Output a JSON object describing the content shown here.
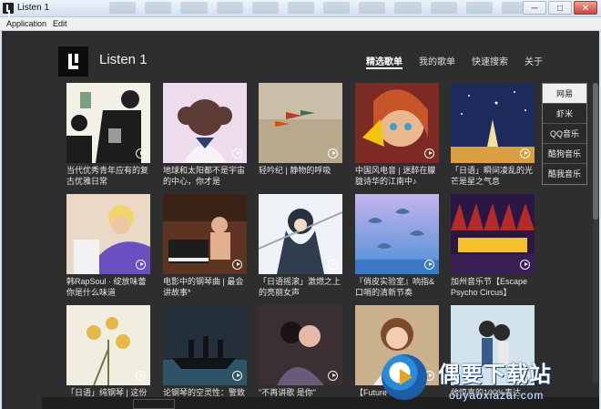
{
  "window": {
    "title": "Listen 1",
    "controls": {
      "minimize": "─",
      "maximize": "□",
      "close": "✕"
    }
  },
  "menu": {
    "items": [
      "Application",
      "Edit"
    ]
  },
  "header": {
    "app_name": "Listen 1",
    "nav": [
      "精选歌单",
      "我的歌单",
      "快速搜索",
      "关于"
    ],
    "active_nav": "精选歌单"
  },
  "sources": {
    "items": [
      "网易",
      "虾米",
      "QQ音乐",
      "酷狗音乐",
      "酷我音乐"
    ],
    "active": "网易"
  },
  "playlists": [
    {
      "title": "当代优秀青年应有的复古优雅日常",
      "art": "art-silhouette",
      "play_icon": "play-circle-icon"
    },
    {
      "title": "地球和太阳都不是宇宙的中心，你才是",
      "art": "art-schoolgirl",
      "play_icon": "play-circle-icon"
    },
    {
      "title": "轻吟纪 | 静物的呼吸",
      "art": "art-autumn-leaves",
      "play_icon": "play-circle-icon"
    },
    {
      "title": "中国风电音 | 迷醉在朦胧诗华的江南中♪",
      "art": "art-anime-girl",
      "play_icon": "play-circle-icon"
    },
    {
      "title": "「日语」瞬间凌乱的光芒是星之气息",
      "art": "art-starry-night",
      "play_icon": "play-circle-icon"
    },
    {
      "title": "韩RapSoul · 绽放味蕾你是什么味道",
      "art": "art-rap-man",
      "play_icon": "play-circle-icon"
    },
    {
      "title": "电影中的钢琴曲 | 最会讲故事*",
      "art": "art-piano",
      "play_icon": "play-circle-icon"
    },
    {
      "title": "「日语摇滚」激燃之上的亮丽女声",
      "art": "art-anime-sword",
      "play_icon": "play-circle-icon"
    },
    {
      "title": "『俏皮实验室』响指&口哨的清新节奏",
      "art": "art-dolphins",
      "play_icon": "play-circle-icon"
    },
    {
      "title": "加州音乐节【Escape Psycho Circus】",
      "art": "art-escape",
      "play_icon": "play-circle-icon"
    },
    {
      "title": "「日语」纯钢琴 | 这份",
      "art": "art-flowers",
      "play_icon": "play-circle-icon"
    },
    {
      "title": "论钢琴的空灵性：警致",
      "art": "art-ship",
      "play_icon": "play-circle-icon"
    },
    {
      "title": "\"不再讲歌 是你\"",
      "art": "art-couple",
      "play_icon": "play-circle-icon"
    },
    {
      "title": "【Future Bass】",
      "art": "art-woman",
      "play_icon": "play-circle-icon"
    },
    {
      "title": "他惊喜的100%表达",
      "art": "art-illustration-couple",
      "play_icon": "play-circle-icon"
    }
  ],
  "watermark": {
    "title": "偶要下载站",
    "url": "ouyaoxiazai.com"
  },
  "colors": {
    "app_background": "#2e2e2e",
    "titlebar": "#d3e0ee",
    "accent_white": "#ffffff",
    "watermark_blue": "#1a5fa8"
  }
}
